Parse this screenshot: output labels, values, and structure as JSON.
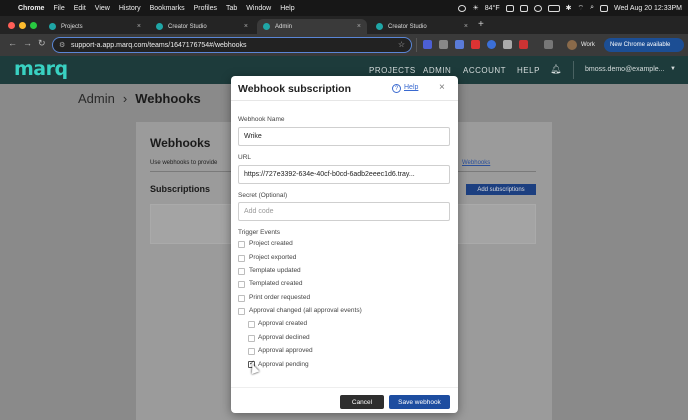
{
  "menubar": {
    "app": "Chrome",
    "items": [
      "File",
      "Edit",
      "View",
      "History",
      "Bookmarks",
      "Profiles",
      "Tab",
      "Window",
      "Help"
    ],
    "weather": "84°F",
    "datetime": "Wed Aug 20  12:33PM"
  },
  "tabs": [
    {
      "label": "Projects"
    },
    {
      "label": "Creator Studio"
    },
    {
      "label": "Admin"
    },
    {
      "label": "Creator Studio"
    }
  ],
  "address": {
    "url": "support-a.app.marq.com/teams/1647176754#/webhooks"
  },
  "chrome": {
    "profile": "Work",
    "new_chrome": "New Chrome available"
  },
  "app": {
    "logo": "marq",
    "nav": [
      "PROJECTS",
      "ADMIN",
      "ACCOUNT",
      "HELP"
    ],
    "user": "bmoss.demo@example..."
  },
  "breadcrumb": {
    "parent": "Admin",
    "sep": "›",
    "current": "Webhooks"
  },
  "card": {
    "title": "Webhooks",
    "desc": "Use webhooks to provide",
    "link": "Webhooks",
    "subs": "Subscriptions",
    "add": "Add subscriptions"
  },
  "modal": {
    "title": "Webhook subscription",
    "help": "Help",
    "close": "×",
    "name_label": "Webhook Name",
    "name_value": "Wrike",
    "url_label": "URL",
    "url_value": "https://727e3392-634e-40cf-b0cd-6adb2eeec1d6.tray...",
    "secret_label": "Secret (Optional)",
    "secret_placeholder": "Add code",
    "events_label": "Trigger Events",
    "events": [
      {
        "label": "Project created",
        "checked": false
      },
      {
        "label": "Project exported",
        "checked": false
      },
      {
        "label": "Template updated",
        "checked": false
      },
      {
        "label": "Templated created",
        "checked": false
      },
      {
        "label": "Print order requested",
        "checked": false
      },
      {
        "label": "Approval changed (all approval events)",
        "checked": false
      },
      {
        "label": "Approval created",
        "checked": false
      },
      {
        "label": "Approval declined",
        "checked": false
      },
      {
        "label": "Approval approved",
        "checked": false
      },
      {
        "label": "Approval pending",
        "checked": true
      }
    ],
    "cancel": "Cancel",
    "save": "Save webhook"
  },
  "colors": {
    "accent": "#1d4da0",
    "brand": "#39d1c2",
    "header": "#1d3b3b"
  }
}
